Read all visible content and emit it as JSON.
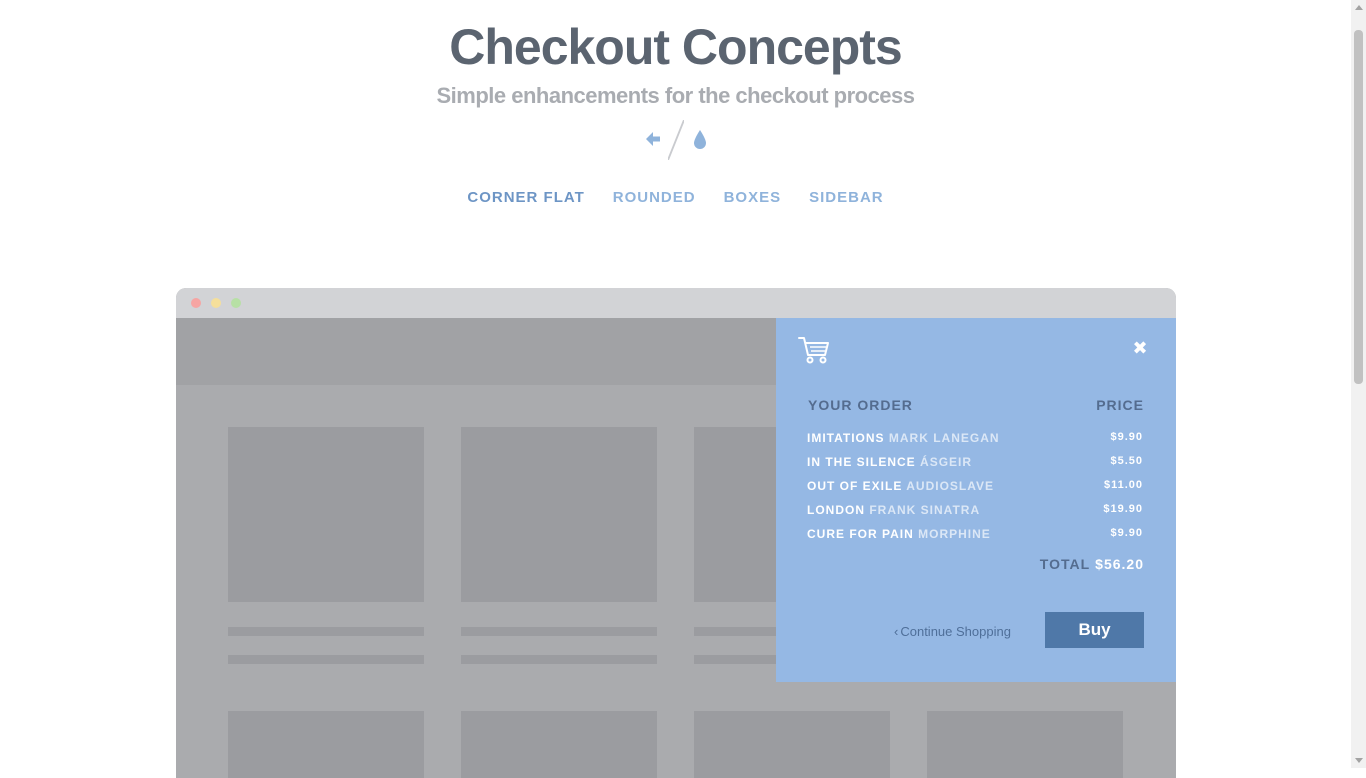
{
  "header": {
    "title": "Checkout Concepts",
    "subtitle": "Simple enhancements for the checkout process",
    "icons": [
      "arrow-left-icon",
      "drop-icon"
    ]
  },
  "tabs": [
    {
      "label": "CORNER FLAT",
      "active": true
    },
    {
      "label": "ROUNDED",
      "active": false
    },
    {
      "label": "BOXES",
      "active": false
    },
    {
      "label": "SIDEBAR",
      "active": false
    }
  ],
  "cart": {
    "your_order_label": "YOUR ORDER",
    "price_label": "PRICE",
    "items": [
      {
        "title": "IMITATIONS",
        "artist": "MARK LANEGAN",
        "price": "$9.90"
      },
      {
        "title": "IN THE SILENCE",
        "artist": "ÁSGEIR",
        "price": "$5.50"
      },
      {
        "title": "OUT OF EXILE",
        "artist": "AUDIOSLAVE",
        "price": "$11.00"
      },
      {
        "title": "LONDON",
        "artist": "FRANK SINATRA",
        "price": "$19.90"
      },
      {
        "title": "CURE FOR PAIN",
        "artist": "MORPHINE",
        "price": "$9.90"
      }
    ],
    "total_label": "TOTAL",
    "total_value": "$56.20",
    "continue_label": "Continue Shopping",
    "continue_chevron": "‹",
    "buy_label": "Buy",
    "close_glyph": "✖"
  },
  "colors": {
    "title": "#5b6470",
    "subtitle": "#a9acb1",
    "accent": "#8fb3db",
    "panel": "#95b8e4",
    "button": "#4f78a8",
    "window": "#aaabae"
  }
}
